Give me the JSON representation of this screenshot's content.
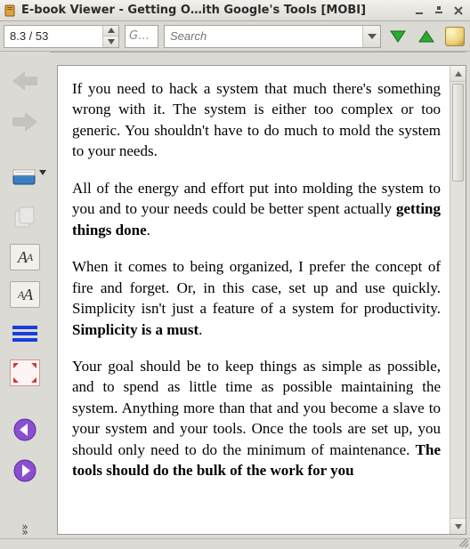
{
  "window": {
    "title": "E-book Viewer - Getting O…ith Google's Tools [MOBI]"
  },
  "toolbar": {
    "page_position": "8.3 / 53",
    "go_placeholder": "G…",
    "search_placeholder": "Search"
  },
  "content": {
    "p1_a": "If you need to hack a system that much there's something wrong with it. The system is either too complex or too generic. You shouldn't have to do much to mold the system to your needs.",
    "p2_a": "All of the energy and effort put into molding the system to you and to your needs could be better spent actually ",
    "p2_b": "getting things done",
    "p2_c": ".",
    "p3_a": "When it comes to being organized, I prefer the concept of fire and forget. Or, in this case, set up and use quickly. Simplicity isn't just a feature of a system for productivity. ",
    "p3_b": "Simplicity is a must",
    "p3_c": ".",
    "p4_a": "Your goal should be to keep things as simple as possible, and to spend as little time as possible maintaining the system. Anything more than that and you become a slave to your system and your tools. Once the tools are set up, you should only need to do the minimum of maintenance. ",
    "p4_b": "The tools should do the bulk of the work for you"
  }
}
